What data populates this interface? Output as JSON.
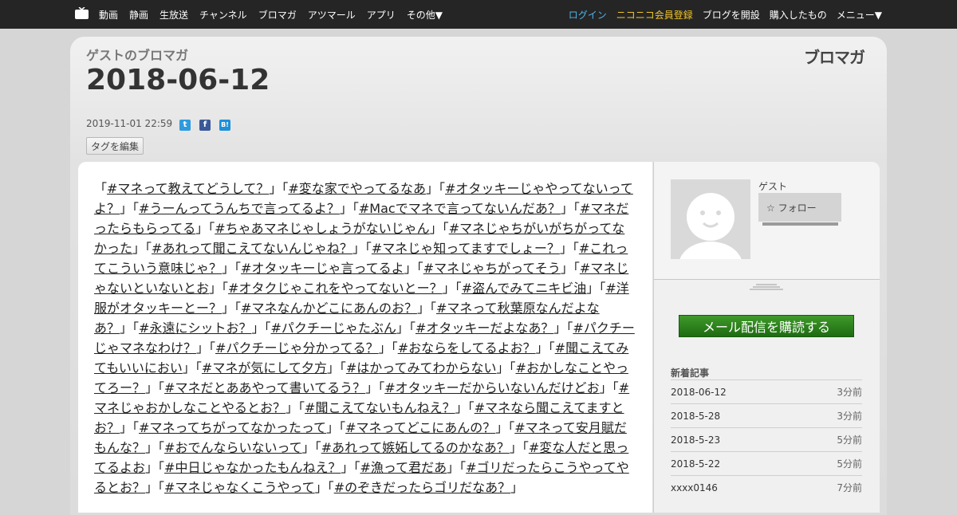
{
  "nav": {
    "left": [
      "動画",
      "静画",
      "生放送",
      "チャンネル",
      "ブロマガ",
      "アツマール",
      "アプリ",
      "その他▼"
    ],
    "login": "ログイン",
    "register": "ニコニコ会員登録",
    "right": [
      "ブログを開設",
      "購入したもの",
      "メニュー▼"
    ]
  },
  "header": {
    "blog_name": "ゲストのブロマガ",
    "title": "2018-06-12",
    "brand_logo": "ブロマガ",
    "date": "2019-11-01 22:59",
    "tag_edit": "タグを編集"
  },
  "article": {
    "tags": [
      "#マネって教えてどうして？",
      "#変な家でやってるなあ",
      "#オタッキーじゃやってないってよ？",
      "#うーんってうんちで言ってるよ？",
      "#Macでマネで言ってないんだあ？",
      "#マネだったらもらってる",
      "#ちゃあマネじゃしょうがないじゃん",
      "#マネじゃちがいがちがってなかった",
      "#あれって聞こえてないんじゃね？",
      "#マネじゃ知ってますでしょー？",
      "#これってこういう意味じゃ？",
      "#オタッキーじゃ言ってるよ",
      "#マネじゃちがってそう",
      "#マネじゃないといないとお",
      "#オタクじゃこれをやってないとー？",
      "#盗んでみてニキビ油",
      "#洋服がオタッキーとー？",
      "#マネなんかどこにあんのお？",
      "#マネって秋葉原なんだよなあ？",
      "#永遠にシットお？",
      "#パクチーじゃたぶん",
      "#オタッキーだよなあ？",
      "#パクチーじゃマネなわけ？",
      "#パクチーじゃ分かってる？",
      "#おならをしてるよお？",
      "#聞こえてみてもいいにおい",
      "#マネが気にして夕方",
      "#はかってみてわからない",
      "#おかしなことやってろー？",
      "#マネだとああやって書いてるう？",
      "#オタッキーだからいないんだけどお",
      "#マネじゃおかしなことやるとお？",
      "#聞こえてないもんねえ？",
      "#マネなら聞こえてますとお？",
      "#マネってちがってなかったって",
      "#マネってどこにあんの？",
      "#マネって安月賦だもんな？",
      "#おでんならいないって",
      "#あれって嫉妬してるのかなあ？",
      "#変な人だと思ってるよお",
      "#中日じゃなかったもんねえ？",
      "#漁って君だあ",
      "#ゴリだったらこうやってやるとお？",
      "#マネじゃなくこうやって",
      "#のぞきだったらゴリだなあ？"
    ]
  },
  "sidebar": {
    "author": "ゲスト",
    "follow": "フォロー",
    "subscribe": "メール配信を購読する",
    "recent_title": "新着記事",
    "recent": [
      {
        "title": "2018-06-12",
        "ago": "3分前"
      },
      {
        "title": "2018-5-28",
        "ago": "3分前"
      },
      {
        "title": "2018-5-23",
        "ago": "5分前"
      },
      {
        "title": "2018-5-22",
        "ago": "5分前"
      },
      {
        "title": "xxxx0146",
        "ago": "7分前"
      }
    ]
  },
  "colors": {
    "topbar": "#252525",
    "login": "#4fb4e8",
    "register": "#f0c52a",
    "subscribe": "#2e8a1e"
  }
}
